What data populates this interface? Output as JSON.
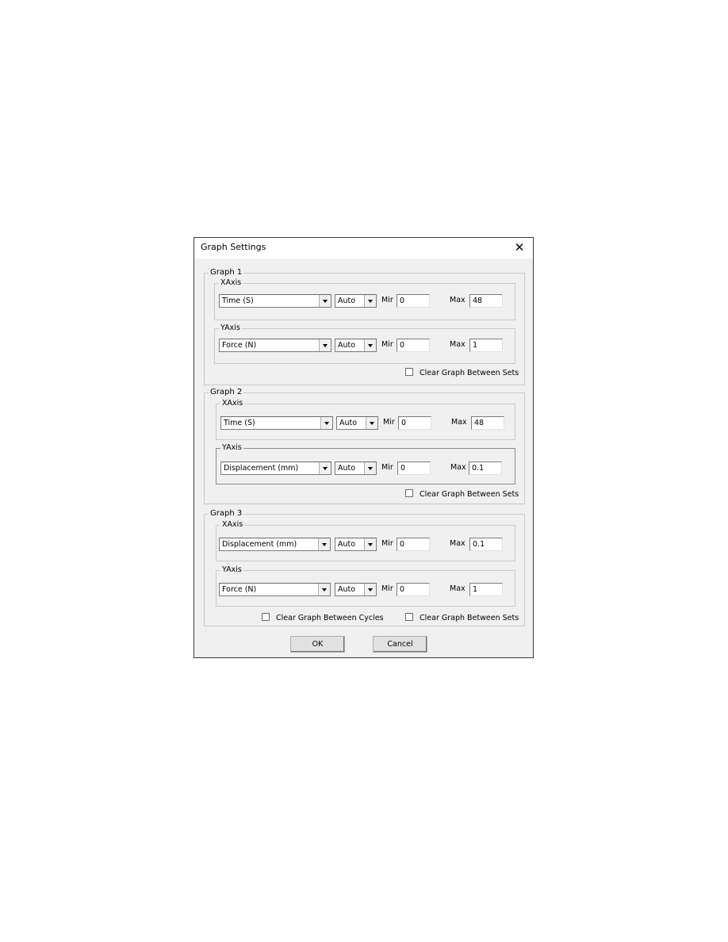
{
  "dialog": {
    "title": "Graph Settings",
    "close_icon": "close-icon"
  },
  "graphs": [
    {
      "label": "Graph 1",
      "xaxis": {
        "label": "XAxis",
        "quantity": "Time (S)",
        "mode": "Auto",
        "min_label": "Mir",
        "min": "0",
        "max_label": "Max",
        "max": "48"
      },
      "yaxis": {
        "label": "YAxis",
        "quantity": "Force (N)",
        "mode": "Auto",
        "min_label": "Mir",
        "min": "0",
        "max_label": "Max",
        "max": "1"
      },
      "clear_sets_label": "Clear Graph Between Sets",
      "clear_sets_checked": false
    },
    {
      "label": "Graph 2",
      "xaxis": {
        "label": "XAxis",
        "quantity": "Time (S)",
        "mode": "Auto",
        "min_label": "Mir",
        "min": "0",
        "max_label": "Max",
        "max": "48"
      },
      "yaxis": {
        "label": "YAxis",
        "quantity": "Displacement (mm)",
        "mode": "Auto",
        "min_label": "Mir",
        "min": "0",
        "max_label": "Max",
        "max": "0.1"
      },
      "clear_sets_label": "Clear Graph Between Sets",
      "clear_sets_checked": false
    },
    {
      "label": "Graph 3",
      "xaxis": {
        "label": "XAxis",
        "quantity": "Displacement (mm)",
        "mode": "Auto",
        "min_label": "Mir",
        "min": "0",
        "max_label": "Max",
        "max": "0.1"
      },
      "yaxis": {
        "label": "YAxis",
        "quantity": "Force (N)",
        "mode": "Auto",
        "min_label": "Mir",
        "min": "0",
        "max_label": "Max",
        "max": "1"
      },
      "clear_cycles_label": "Clear Graph Between Cycles",
      "clear_cycles_checked": false,
      "clear_sets_label": "Clear Graph Between Sets",
      "clear_sets_checked": false
    }
  ],
  "buttons": {
    "ok": "OK",
    "cancel": "Cancel"
  }
}
